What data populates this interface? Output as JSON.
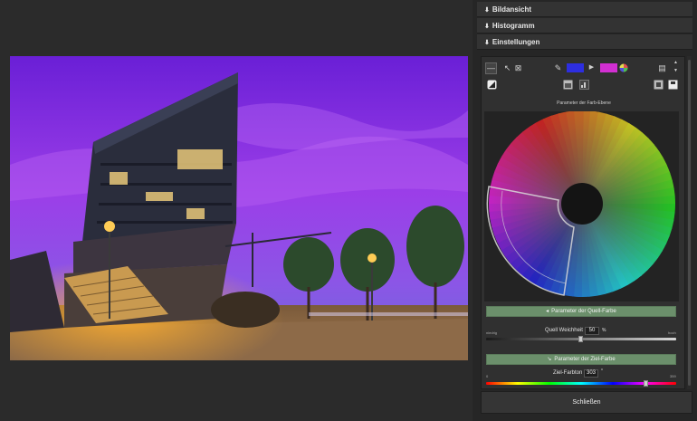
{
  "panel": {
    "sections": [
      {
        "label": "Bildansicht",
        "icon": "disclosure-arrow-icon"
      },
      {
        "label": "Histogramm",
        "icon": "disclosure-arrow-icon"
      },
      {
        "label": "Einstellungen",
        "icon": "disclosure-arrow-icon"
      }
    ],
    "arrow_glyph": "⬇"
  },
  "settings": {
    "toolbar": {
      "minus_glyph": "—",
      "pointer_glyph": "↖",
      "select_glyph": "⊠",
      "picker_glyph": "✎",
      "play_glyph": "▶",
      "doc_glyph": "▤",
      "stepper_up": "▲",
      "stepper_down": "▼"
    },
    "colors": {
      "source_swatch": "#2d2ee0",
      "target_swatch": "#d22fd2",
      "green_button": "#6b8f6b"
    },
    "wheel_title": "Parameter der Farb-Ebene",
    "source_button": "Parameter der Quell-Farbe",
    "source_softness": {
      "label": "Quell Weichheit",
      "value": "50",
      "unit": "%",
      "min_label": "niedrig",
      "max_label": "hoch",
      "fraction": 0.5
    },
    "target_button": "Parameter der Ziel-Farbe",
    "target_hue": {
      "label": "Ziel-Farbton",
      "value": "303",
      "unit": "°",
      "min_label": "0",
      "max_label": "359",
      "fraction": 0.844
    }
  },
  "footer": {
    "close_label": "Schließen"
  }
}
